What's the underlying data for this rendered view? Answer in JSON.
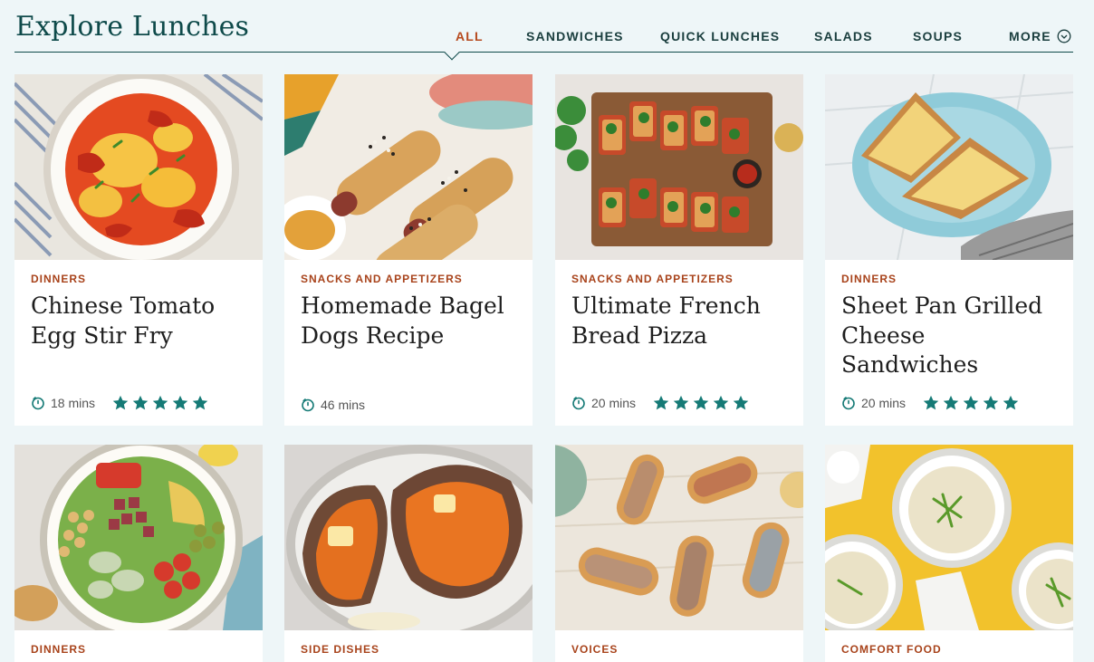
{
  "header": {
    "title": "Explore Lunches",
    "tabs": [
      {
        "label": "ALL"
      },
      {
        "label": "SANDWICHES"
      },
      {
        "label": "QUICK LUNCHES"
      },
      {
        "label": "SALADS"
      },
      {
        "label": "SOUPS"
      },
      {
        "label": "MORE"
      }
    ]
  },
  "colors": {
    "accent": "#0e4a4a",
    "category": "#a8431b",
    "star": "#157a76"
  },
  "cards": [
    {
      "category": "DINNERS",
      "title": "Chinese Tomato Egg Stir Fry",
      "time": "18 mins",
      "rating": 5
    },
    {
      "category": "SNACKS AND APPETIZERS",
      "title": "Homemade Bagel Dogs Recipe",
      "time": "46 mins",
      "rating": 0
    },
    {
      "category": "SNACKS AND APPETIZERS",
      "title": "Ultimate French Bread Pizza",
      "time": "20 mins",
      "rating": 5
    },
    {
      "category": "DINNERS",
      "title": "Sheet Pan Grilled Cheese Sandwiches",
      "time": "20 mins",
      "rating": 5
    },
    {
      "category": "DINNERS"
    },
    {
      "category": "SIDE DISHES"
    },
    {
      "category": "VOICES"
    },
    {
      "category": "COMFORT FOOD"
    }
  ]
}
